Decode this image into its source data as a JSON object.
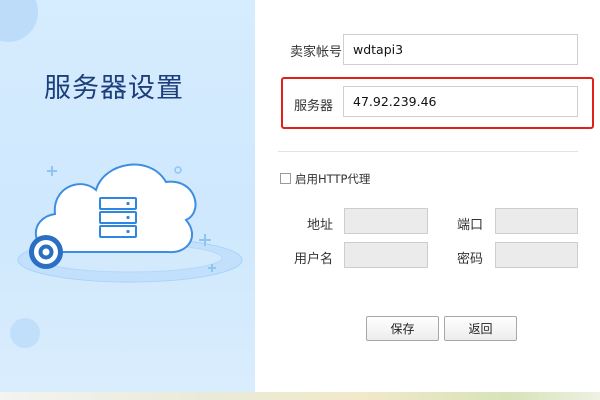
{
  "left": {
    "title": "服务器设置"
  },
  "form": {
    "seller_account": {
      "label": "卖家帐号",
      "value": "wdtapi3"
    },
    "server": {
      "label": "服务器",
      "value": "47.92.239.46"
    },
    "proxy": {
      "checkbox_label": "启用HTTP代理",
      "checked": false,
      "address": {
        "label": "地址",
        "value": ""
      },
      "port": {
        "label": "端口",
        "value": ""
      },
      "username": {
        "label": "用户名",
        "value": ""
      },
      "password": {
        "label": "密码",
        "value": ""
      }
    }
  },
  "buttons": {
    "save": "保存",
    "back": "返回"
  },
  "colors": {
    "accent": "#2d8cf0",
    "highlight": "#e0201b",
    "title": "#1c3f7c"
  }
}
